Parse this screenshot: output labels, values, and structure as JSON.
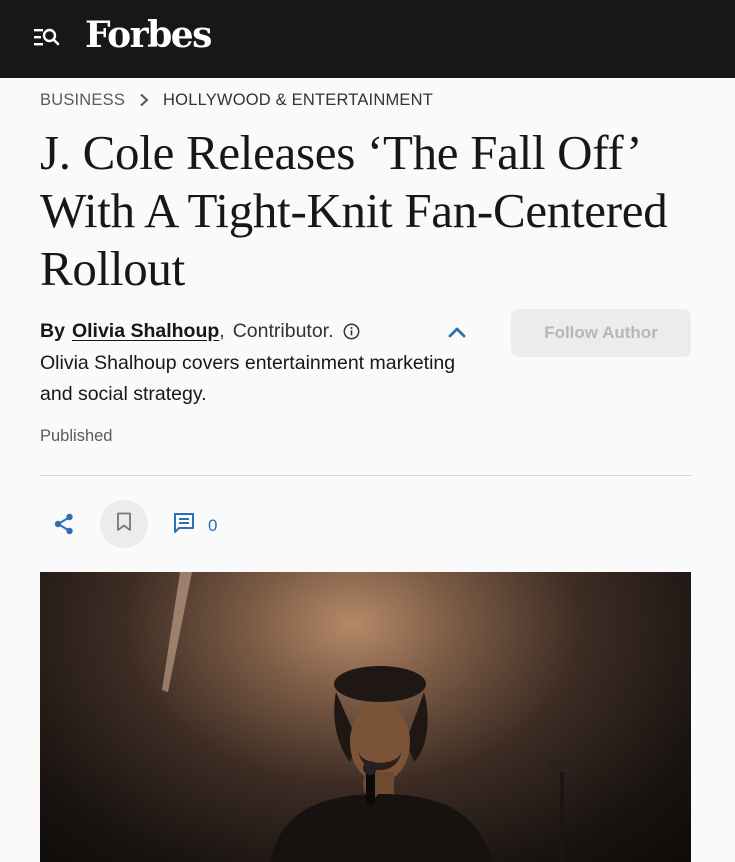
{
  "header": {
    "logo_text": "Forbes",
    "menu_icon": "menu-search-icon",
    "background": "#181716"
  },
  "breadcrumb": {
    "section": "BUSINESS",
    "separator_icon": "chevron-right-icon",
    "subsection": "HOLLYWOOD & ENTERTAINMENT"
  },
  "article": {
    "title": "J. Cole Releases ‘The Fall Off’ With A Tight-Knit Fan-Centered Rollout",
    "byline": {
      "prefix": "By",
      "author": "Olivia Shalhoup",
      "comma": ",",
      "role": "Contributor.",
      "info_icon": "info-icon",
      "collapse_icon": "chevron-up-icon"
    },
    "follow_label": "Follow Author",
    "bio": "Olivia Shalhoup covers entertainment marketing and social strategy.",
    "published_label": "Published"
  },
  "actions": {
    "share_icon": "share-icon",
    "bookmark_icon": "bookmark-icon",
    "comment_icon": "comment-icon",
    "comment_count": "0",
    "accent_color": "#2f6fb0"
  },
  "hero_image": {
    "description_icon": "photo"
  }
}
